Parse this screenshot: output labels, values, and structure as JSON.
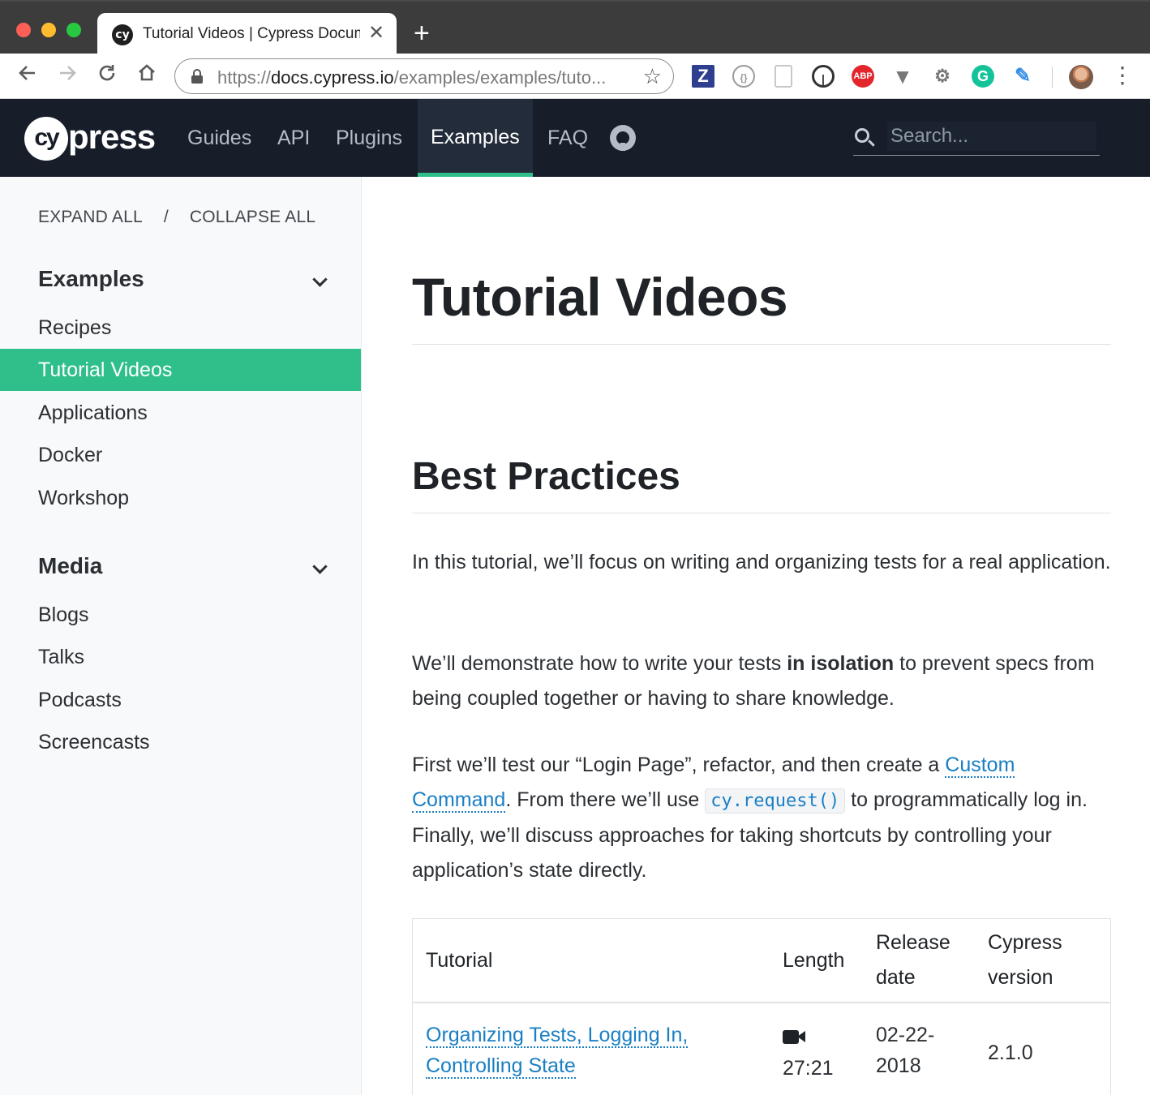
{
  "browser": {
    "tab_title": "Tutorial Videos | Cypress Documentation",
    "favicon_text": "cy",
    "new_tab_glyph": "+",
    "close_glyph": "✕",
    "url_scheme": "https://",
    "url_host": "docs.cypress.io",
    "url_path": "/examples/examples/tuto...",
    "star_glyph": "☆",
    "ext_z_label": "Z",
    "ext_abp_label": "ABP",
    "ext_gram_label": "G"
  },
  "site": {
    "logo_cy": "cy",
    "logo_press": "press",
    "nav": [
      "Guides",
      "API",
      "Plugins",
      "Examples",
      "FAQ"
    ],
    "active_nav": "Examples",
    "search_placeholder": "Search...",
    "accent_color": "#2fbf8b",
    "header_bg": "#171e2a",
    "link_color": "#1a7fc4"
  },
  "sidebar": {
    "expand_all": "EXPAND ALL",
    "separator": "/",
    "collapse_all": "COLLAPSE ALL",
    "groups": [
      {
        "title": "Examples",
        "items": [
          "Recipes",
          "Tutorial Videos",
          "Applications",
          "Docker",
          "Workshop"
        ]
      },
      {
        "title": "Media",
        "items": [
          "Blogs",
          "Talks",
          "Podcasts",
          "Screencasts"
        ]
      }
    ],
    "active_item": "Tutorial Videos"
  },
  "main": {
    "page_title": "Tutorial Videos",
    "section_title": "Best Practices",
    "p1": "In this tutorial, we’ll focus on writing and organizing tests for a real application.",
    "p2_before": "We’ll demonstrate how to write your tests ",
    "p2_bold": "in isolation",
    "p2_after": " to prevent specs from being coupled together or having to share knowledge.",
    "p3_before": "First we’ll test our “Login Page”, refactor, and then create a ",
    "p3_link": "Custom Command",
    "p3_mid": ". From there we’ll use ",
    "p3_code": "cy.request()",
    "p3_after": " to programmatically log in. Finally, we’ll discuss approaches for taking shortcuts by controlling your application’s state directly.",
    "table": {
      "headers": [
        "Tutorial",
        "Length",
        "Release date",
        "Cypress version"
      ],
      "rows": [
        {
          "tutorial": "Organizing Tests, Logging In, Controlling State",
          "length": "27:21",
          "release_date": "02-22-2018",
          "version": "2.1.0"
        }
      ]
    }
  }
}
